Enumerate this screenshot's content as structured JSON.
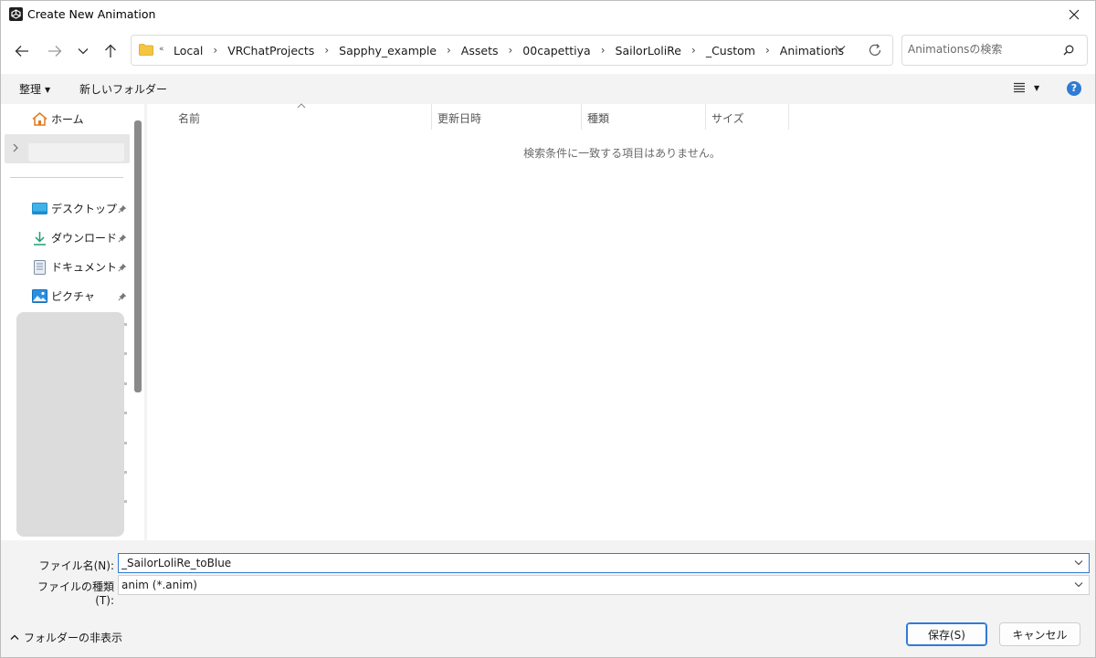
{
  "window": {
    "title": "Create New Animation"
  },
  "navigation": {
    "overflow_marker": "«",
    "breadcrumbs": [
      "Local",
      "VRChatProjects",
      "Sapphy_example",
      "Assets",
      "00capettiya",
      "SailorLoliRe",
      "_Custom",
      "Animations"
    ],
    "breadcrumb_separator": "›",
    "search_placeholder": "Animationsの検索"
  },
  "toolbar": {
    "organize_label": "整理",
    "new_folder_label": "新しいフォルダー",
    "help_label": "?"
  },
  "sidebar": {
    "home_label": "ホーム",
    "quick_access": [
      {
        "label": "デスクトップ",
        "icon": "desktop-icon"
      },
      {
        "label": "ダウンロード",
        "icon": "download-icon"
      },
      {
        "label": "ドキュメント",
        "icon": "document-icon"
      },
      {
        "label": "ピクチャ",
        "icon": "pictures-icon"
      }
    ]
  },
  "file_list": {
    "columns": [
      "名前",
      "更新日時",
      "種類",
      "サイズ"
    ],
    "empty_message": "検索条件に一致する項目はありません。"
  },
  "form": {
    "filename_label": "ファイル名(N):",
    "filename_value": "_SailorLoliRe_toBlue",
    "filetype_label": "ファイルの種類(T):",
    "filetype_value": "anim (*.anim)"
  },
  "footer": {
    "hide_folders_label": "フォルダーの非表示",
    "save_label": "保存(S)",
    "cancel_label": "キャンセル"
  },
  "colors": {
    "accent": "#2f7bd6",
    "folder": "#f4c443"
  }
}
